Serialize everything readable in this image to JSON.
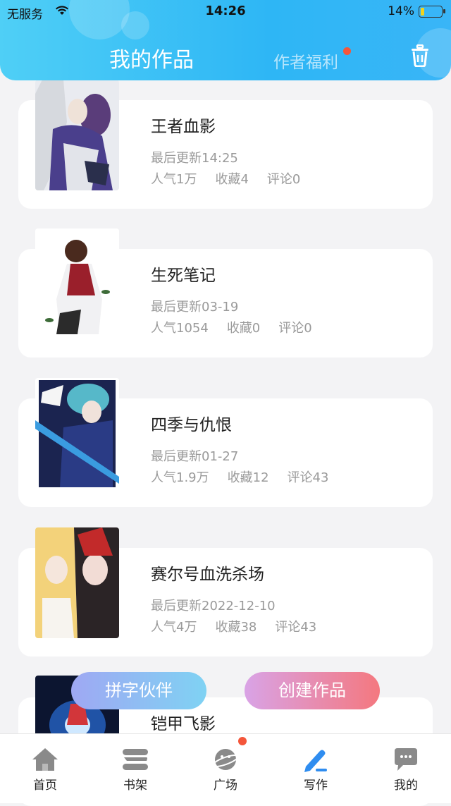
{
  "status_bar": {
    "carrier": "无服务",
    "time": "14:26",
    "battery": "14%"
  },
  "header": {
    "title": "我的作品",
    "tab2": "作者福利"
  },
  "works": [
    {
      "title": "王者血影",
      "updated": "最后更新14:25",
      "popularity": "人气1万",
      "favorites": "收藏4",
      "comments": "评论0"
    },
    {
      "title": "生死笔记",
      "updated": "最后更新03-19",
      "popularity": "人气1054",
      "favorites": "收藏0",
      "comments": "评论0"
    },
    {
      "title": "四季与仇恨",
      "updated": "最后更新01-27",
      "popularity": "人气1.9万",
      "favorites": "收藏12",
      "comments": "评论43"
    },
    {
      "title": "赛尔号血洗杀场",
      "updated": "最后更新2022-12-10",
      "popularity": "人气4万",
      "favorites": "收藏38",
      "comments": "评论43"
    },
    {
      "title": "铠甲飞影"
    }
  ],
  "actions": {
    "partner": "拼字伙伴",
    "create": "创建作品"
  },
  "nav": [
    "首页",
    "书架",
    "广场",
    "写作",
    "我的"
  ],
  "colors": {
    "header": "#2eb6f5",
    "notify_dot": "#f4563a",
    "active_nav": "#2f8df0"
  }
}
